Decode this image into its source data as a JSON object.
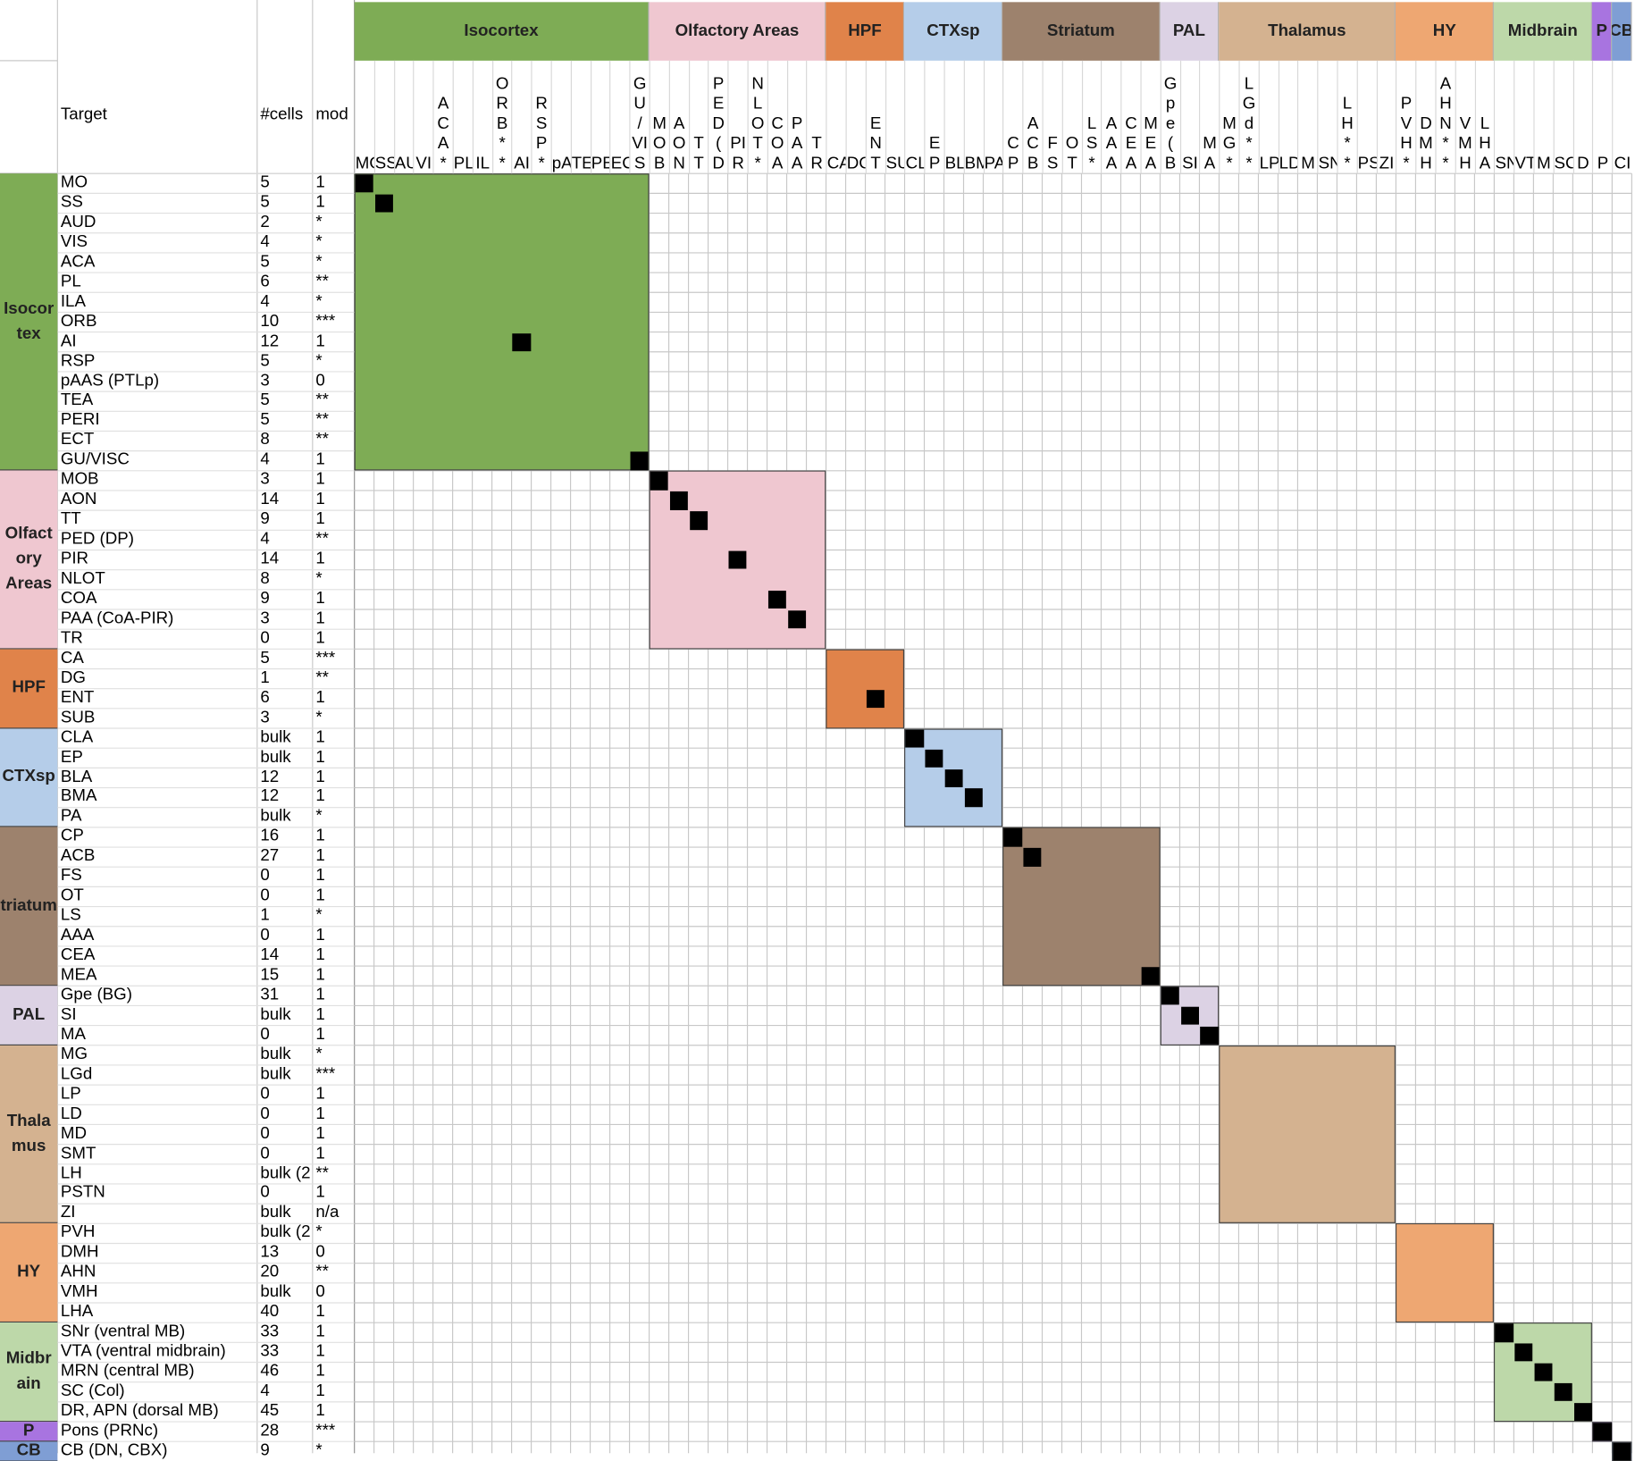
{
  "headers": {
    "target": "Target",
    "cells": "#cells",
    "mod": "mod"
  },
  "groups": [
    {
      "key": "isocortex",
      "label": "Isocortex",
      "row_label": "Isocor\ntex",
      "color": "#7eac55"
    },
    {
      "key": "olfactory",
      "label": "Olfactory Areas",
      "row_label": "Olfact\nory\nAreas",
      "color": "#efc7d0"
    },
    {
      "key": "hpf",
      "label": "HPF",
      "row_label": "HPF",
      "color": "#e0834a"
    },
    {
      "key": "ctxsp",
      "label": "CTXsp",
      "row_label": "CTXsp",
      "color": "#b5cde9"
    },
    {
      "key": "striatum",
      "label": "Striatum",
      "row_label": "triatum",
      "color": "#9d826d"
    },
    {
      "key": "pal",
      "label": "PAL",
      "row_label": "PAL",
      "color": "#dcd2e4"
    },
    {
      "key": "thalamus",
      "label": "Thalamus",
      "row_label": "Thala\nmus",
      "color": "#d4b290"
    },
    {
      "key": "hy",
      "label": "HY",
      "row_label": "HY",
      "color": "#eea772"
    },
    {
      "key": "midbrain",
      "label": "Midbrain",
      "row_label": "Midbr\nain",
      "color": "#bdd8a9"
    },
    {
      "key": "p",
      "label": "P",
      "row_label": "P",
      "color": "#a874e0"
    },
    {
      "key": "cb",
      "label": "CB",
      "row_label": "CB",
      "color": "#7f9ed4"
    }
  ],
  "rows": [
    {
      "group": "isocortex",
      "target": "MO",
      "cells": "5",
      "mod": "1"
    },
    {
      "group": "isocortex",
      "target": "SS",
      "cells": "5",
      "mod": "1"
    },
    {
      "group": "isocortex",
      "target": "AUD",
      "cells": "2",
      "mod": "*"
    },
    {
      "group": "isocortex",
      "target": "VIS",
      "cells": "4",
      "mod": "*"
    },
    {
      "group": "isocortex",
      "target": "ACA",
      "cells": "5",
      "mod": "*"
    },
    {
      "group": "isocortex",
      "target": "PL",
      "cells": "6",
      "mod": "**"
    },
    {
      "group": "isocortex",
      "target": "ILA",
      "cells": "4",
      "mod": "*"
    },
    {
      "group": "isocortex",
      "target": "ORB",
      "cells": "10",
      "mod": "***"
    },
    {
      "group": "isocortex",
      "target": "AI",
      "cells": "12",
      "mod": "1"
    },
    {
      "group": "isocortex",
      "target": "RSP",
      "cells": "5",
      "mod": "*"
    },
    {
      "group": "isocortex",
      "target": "pAAS (PTLp)",
      "cells": "3",
      "mod": "0"
    },
    {
      "group": "isocortex",
      "target": "TEA",
      "cells": "5",
      "mod": "**"
    },
    {
      "group": "isocortex",
      "target": "PERI",
      "cells": "5",
      "mod": "**"
    },
    {
      "group": "isocortex",
      "target": "ECT",
      "cells": "8",
      "mod": "**"
    },
    {
      "group": "isocortex",
      "target": "GU/VISC",
      "cells": "4",
      "mod": "1"
    },
    {
      "group": "olfactory",
      "target": "MOB",
      "cells": "3",
      "mod": "1"
    },
    {
      "group": "olfactory",
      "target": "AON",
      "cells": "14",
      "mod": "1"
    },
    {
      "group": "olfactory",
      "target": "TT",
      "cells": "9",
      "mod": "1"
    },
    {
      "group": "olfactory",
      "target": "PED (DP)",
      "cells": "4",
      "mod": "**"
    },
    {
      "group": "olfactory",
      "target": "PIR",
      "cells": "14",
      "mod": "1"
    },
    {
      "group": "olfactory",
      "target": "NLOT",
      "cells": "8",
      "mod": "*"
    },
    {
      "group": "olfactory",
      "target": "COA",
      "cells": "9",
      "mod": "1"
    },
    {
      "group": "olfactory",
      "target": "PAA (CoA-PIR)",
      "cells": "3",
      "mod": "1"
    },
    {
      "group": "olfactory",
      "target": "TR",
      "cells": "0",
      "mod": "1"
    },
    {
      "group": "hpf",
      "target": "CA",
      "cells": "5",
      "mod": "***"
    },
    {
      "group": "hpf",
      "target": "DG",
      "cells": "1",
      "mod": "**"
    },
    {
      "group": "hpf",
      "target": "ENT",
      "cells": "6",
      "mod": "1"
    },
    {
      "group": "hpf",
      "target": "SUB",
      "cells": "3",
      "mod": "*"
    },
    {
      "group": "ctxsp",
      "target": "CLA",
      "cells": "bulk",
      "mod": "1"
    },
    {
      "group": "ctxsp",
      "target": "EP",
      "cells": "bulk",
      "mod": "1"
    },
    {
      "group": "ctxsp",
      "target": "BLA",
      "cells": "12",
      "mod": "1"
    },
    {
      "group": "ctxsp",
      "target": "BMA",
      "cells": "12",
      "mod": "1"
    },
    {
      "group": "ctxsp",
      "target": "PA",
      "cells": "bulk",
      "mod": "*"
    },
    {
      "group": "striatum",
      "target": "CP",
      "cells": "16",
      "mod": "1"
    },
    {
      "group": "striatum",
      "target": "ACB",
      "cells": "27",
      "mod": "1"
    },
    {
      "group": "striatum",
      "target": "FS",
      "cells": "0",
      "mod": "1"
    },
    {
      "group": "striatum",
      "target": "OT",
      "cells": "0",
      "mod": "1"
    },
    {
      "group": "striatum",
      "target": "LS",
      "cells": "1",
      "mod": "*"
    },
    {
      "group": "striatum",
      "target": "AAA",
      "cells": "0",
      "mod": "1"
    },
    {
      "group": "striatum",
      "target": "CEA",
      "cells": "14",
      "mod": "1"
    },
    {
      "group": "striatum",
      "target": "MEA",
      "cells": "15",
      "mod": "1"
    },
    {
      "group": "pal",
      "target": "Gpe (BG)",
      "cells": "31",
      "mod": "1"
    },
    {
      "group": "pal",
      "target": "SI",
      "cells": "bulk",
      "mod": "1"
    },
    {
      "group": "pal",
      "target": "MA",
      "cells": "0",
      "mod": "1"
    },
    {
      "group": "thalamus",
      "target": "MG",
      "cells": "bulk",
      "mod": "*"
    },
    {
      "group": "thalamus",
      "target": "LGd",
      "cells": "bulk",
      "mod": "***"
    },
    {
      "group": "thalamus",
      "target": "LP",
      "cells": "0",
      "mod": "1"
    },
    {
      "group": "thalamus",
      "target": "LD",
      "cells": "0",
      "mod": "1"
    },
    {
      "group": "thalamus",
      "target": "MD",
      "cells": "0",
      "mod": "1"
    },
    {
      "group": "thalamus",
      "target": "SMT",
      "cells": "0",
      "mod": "1"
    },
    {
      "group": "thalamus",
      "target": "LH",
      "cells": "bulk (2",
      "mod": "**"
    },
    {
      "group": "thalamus",
      "target": "PSTN",
      "cells": "0",
      "mod": "1"
    },
    {
      "group": "thalamus",
      "target": "ZI",
      "cells": "bulk",
      "mod": "n/a"
    },
    {
      "group": "hy",
      "target": "PVH",
      "cells": "bulk (2",
      "mod": "*"
    },
    {
      "group": "hy",
      "target": "DMH",
      "cells": "13",
      "mod": "0"
    },
    {
      "group": "hy",
      "target": "AHN",
      "cells": "20",
      "mod": "**"
    },
    {
      "group": "hy",
      "target": "VMH",
      "cells": "bulk",
      "mod": "0"
    },
    {
      "group": "hy",
      "target": "LHA",
      "cells": "40",
      "mod": "1"
    },
    {
      "group": "midbrain",
      "target": "SNr (ventral MB)",
      "cells": "33",
      "mod": "1"
    },
    {
      "group": "midbrain",
      "target": "VTA (ventral midbrain)",
      "cells": "33",
      "mod": "1"
    },
    {
      "group": "midbrain",
      "target": "MRN (central MB)",
      "cells": "46",
      "mod": "1"
    },
    {
      "group": "midbrain",
      "target": "SC (Col)",
      "cells": "4",
      "mod": "1"
    },
    {
      "group": "midbrain",
      "target": "DR, APN (dorsal MB)",
      "cells": "45",
      "mod": "1"
    },
    {
      "group": "p",
      "target": "Pons (PRNc)",
      "cells": "28",
      "mod": "***"
    },
    {
      "group": "cb",
      "target": "CB (DN, CBX)",
      "cells": "9",
      "mod": "*"
    }
  ],
  "column_headers": [
    "MO",
    "SS",
    "AU",
    "VI",
    "A\nC\nA\n*",
    "PL",
    "IL",
    "O\nR\nB\n*\n*",
    "AI",
    "R\nS\nP\n*",
    "pA",
    "TE",
    "PE",
    "EC",
    "G\nU\n/\nVI\nS",
    "M\nO\nB",
    "A\nO\nN",
    "T\nT",
    "P\nE\nD\n(\nD",
    "PI\nR",
    "N\nL\nO\nT\n*",
    "C\nO\nA",
    "P\nA\nA",
    "T\nR",
    "CA",
    "DG",
    "E\nN\nT",
    "SU",
    "CL",
    "E\nP",
    "BL",
    "BM",
    "PA",
    "C\nP",
    "A\nC\nB",
    "F\nS",
    "O\nT",
    "L\nS\n*",
    "A\nA\nA",
    "C\nE\nA",
    "M\nE\nA",
    "G\np\ne\n(\nB",
    "SI",
    "M\nA",
    "M\nG\n*",
    "L\nG\nd\n*\n*",
    "LP",
    "LD",
    "M",
    "SN",
    "L\nH\n*\n*",
    "PS",
    "ZI",
    "P\nV\nH\n*",
    "D\nM\nH",
    "A\nH\nN\n*\n*",
    "V\nM\nH",
    "L\nH\nA",
    "SN",
    "VT",
    "M",
    "SC",
    "D",
    "P",
    "CI"
  ],
  "marks": [
    [
      0,
      0
    ],
    [
      1,
      1
    ],
    [
      8,
      8
    ],
    [
      14,
      14
    ],
    [
      15,
      15
    ],
    [
      16,
      16
    ],
    [
      17,
      17
    ],
    [
      19,
      19
    ],
    [
      21,
      21
    ],
    [
      22,
      22
    ],
    [
      26,
      26
    ],
    [
      28,
      28
    ],
    [
      29,
      29
    ],
    [
      30,
      30
    ],
    [
      31,
      31
    ],
    [
      33,
      33
    ],
    [
      34,
      34
    ],
    [
      40,
      40
    ],
    [
      41,
      41
    ],
    [
      42,
      42
    ],
    [
      43,
      43
    ],
    [
      58,
      58
    ],
    [
      59,
      59
    ],
    [
      60,
      60
    ],
    [
      61,
      61
    ],
    [
      62,
      62
    ],
    [
      63,
      63
    ],
    [
      64,
      64
    ]
  ]
}
